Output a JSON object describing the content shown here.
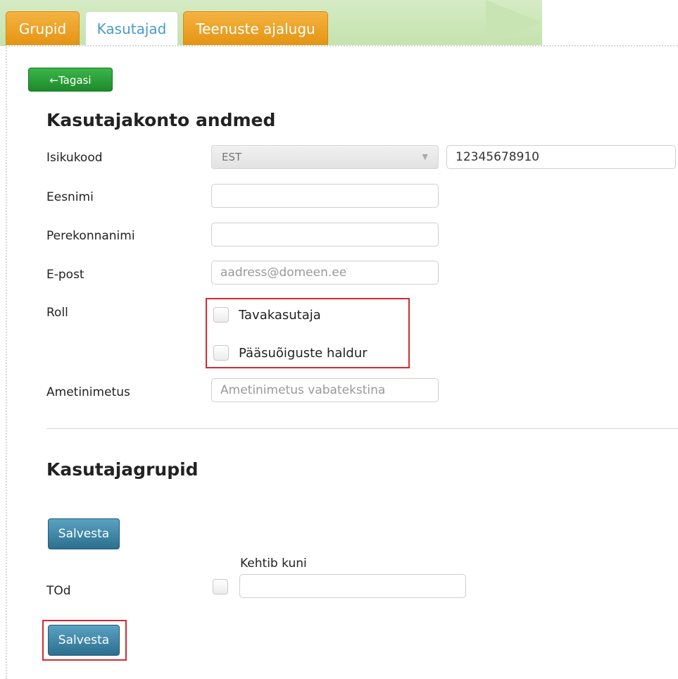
{
  "tabs": [
    {
      "label": "Grupid"
    },
    {
      "label": "Kasutajad"
    },
    {
      "label": "Teenuste ajalugu"
    }
  ],
  "back_button": {
    "label": "←Tagasi"
  },
  "account_section": {
    "title": "Kasutajakonto andmed",
    "fields": {
      "isikukood": {
        "label": "Isikukood",
        "country": "EST",
        "value": "12345678910"
      },
      "eesnimi": {
        "label": "Eesnimi",
        "value": ""
      },
      "perekonnanimi": {
        "label": "Perekonnanimi",
        "value": ""
      },
      "epost": {
        "label": "E-post",
        "placeholder": "aadress@domeen.ee"
      },
      "roll": {
        "label": "Roll",
        "options": [
          {
            "label": "Tavakasutaja",
            "checked": false
          },
          {
            "label": "Pääsuõiguste haldur",
            "checked": false
          }
        ]
      },
      "ametinimetus": {
        "label": "Ametinimetus",
        "placeholder": "Ametinimetus vabatekstina"
      }
    }
  },
  "groups_section": {
    "title": "Kasutajagrupid",
    "save_label": "Salvesta",
    "valid_until_label": "Kehtib kuni",
    "group": {
      "label": "TOd",
      "checked": false,
      "valid_until": ""
    },
    "save_label_bottom": "Salvesta"
  },
  "colors": {
    "tab_orange": "#e49413",
    "active_tab_text": "#4a9ac5",
    "back_button": "#2a9a38",
    "save_button": "#3c86a8",
    "highlight": "#d42a35"
  }
}
